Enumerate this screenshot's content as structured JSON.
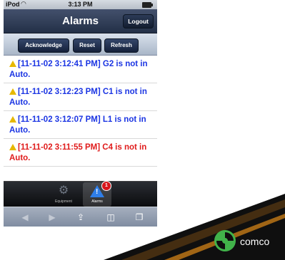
{
  "status_bar": {
    "carrier": "iPod",
    "time": "3:13 PM"
  },
  "nav": {
    "title": "Alarms",
    "logout": "Logout"
  },
  "toolbar": {
    "acknowledge": "Acknowledge",
    "reset": "Reset",
    "refresh": "Refresh"
  },
  "alarms": [
    {
      "text": "[11-11-02 3:12:41 PM] G2 is not in Auto.",
      "color": "#1b35e3"
    },
    {
      "text": "[11-11-02 3:12:23 PM] C1 is not in Auto.",
      "color": "#1b35e3"
    },
    {
      "text": "[11-11-02 3:12:07 PM] L1 is not in Auto.",
      "color": "#1b35e3"
    },
    {
      "text": "[11-11-02 3:11:55 PM] C4 is not in Auto.",
      "color": "#e01b1b"
    }
  ],
  "tabs": [
    {
      "label": "Equipment",
      "icon": "gears-icon"
    },
    {
      "label": "Alarms",
      "icon": "warning-icon",
      "badge": "1"
    }
  ],
  "safari_toolbar": [
    "back-icon",
    "forward-icon",
    "share-icon",
    "bookmarks-icon",
    "tabs-icon"
  ],
  "logo": {
    "text": "comco"
  }
}
